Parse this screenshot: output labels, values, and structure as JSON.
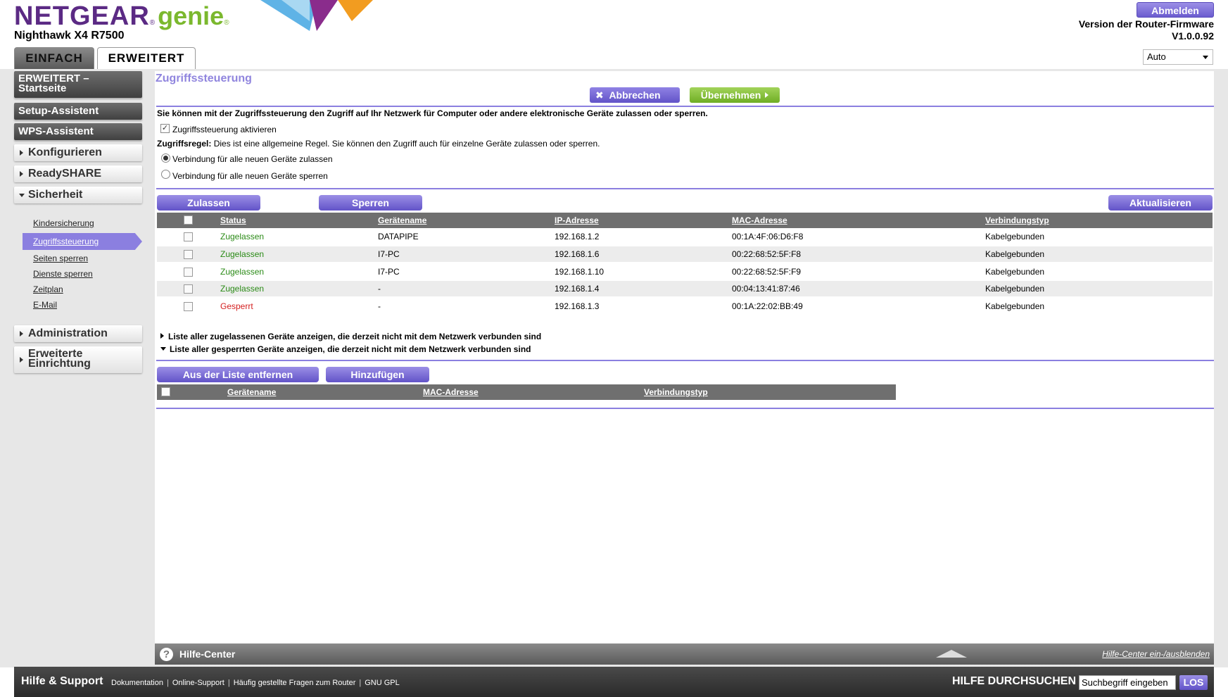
{
  "header": {
    "brand": "NETGEAR",
    "brand_reg": "®",
    "product": "genie",
    "product_reg": "®",
    "model": "Nighthawk X4 R7500",
    "logout_label": "Abmelden",
    "firmware_label": "Version der Router-Firmware",
    "firmware_version": "V1.0.0.92",
    "language_selected": "Auto",
    "tabs": [
      "EINFACH",
      "ERWEITERT"
    ]
  },
  "sidebar": {
    "dark_items": [
      "ERWEITERT –",
      "Startseite",
      "Setup-Assistent",
      "WPS-Assistent"
    ],
    "sections": [
      "Konfigurieren",
      "ReadySHARE",
      "Sicherheit",
      "Administration",
      "Erweiterte",
      "Einrichtung"
    ],
    "security_items": [
      "Kindersicherung",
      "Zugriffssteuerung",
      "Seiten sperren",
      "Dienste sperren",
      "Zeitplan",
      "E-Mail"
    ]
  },
  "content": {
    "title": "Zugriffssteuerung",
    "cancel_label": "Abbrechen",
    "apply_label": "Übernehmen",
    "intro": "Sie können mit der Zugriffssteuerung den Zugriff auf Ihr Netzwerk für Computer oder andere elektronische Geräte zulassen oder sperren.",
    "enable_label": "Zugriffssteuerung aktivieren",
    "rule_label": "Zugriffsregel:",
    "rule_text": "Dies ist eine allgemeine Regel. Sie können den Zugriff auch für einzelne Geräte zulassen oder sperren.",
    "radio_allow": "Verbindung für alle neuen Geräte zulassen",
    "radio_block": "Verbindung für alle neuen Geräte sperren",
    "btn_allow": "Zulassen",
    "btn_block": "Sperren",
    "btn_refresh": "Aktualisieren",
    "table_headers": [
      "Status",
      "Gerätename",
      "IP-Adresse",
      "MAC-Adresse",
      "Verbindungstyp"
    ],
    "rows": [
      {
        "status": "Zugelassen",
        "name": "DATAPIPE",
        "ip": "192.168.1.2",
        "mac": "00:1A:4F:06:D6:F8",
        "type": "Kabelgebunden"
      },
      {
        "status": "Zugelassen",
        "name": "I7-PC",
        "ip": "192.168.1.6",
        "mac": "00:22:68:52:5F:F8",
        "type": "Kabelgebunden"
      },
      {
        "status": "Zugelassen",
        "name": "I7-PC",
        "ip": "192.168.1.10",
        "mac": "00:22:68:52:5F:F9",
        "type": "Kabelgebunden"
      },
      {
        "status": "Zugelassen",
        "name": "-",
        "ip": "192.168.1.4",
        "mac": "00:04:13:41:87:46",
        "type": "Kabelgebunden"
      },
      {
        "status": "Gesperrt",
        "name": "-",
        "ip": "192.168.1.3",
        "mac": "00:1A:22:02:BB:49",
        "type": "Kabelgebunden"
      }
    ],
    "expander_allowed": "Liste aller zugelassenen Geräte anzeigen, die derzeit nicht mit dem Netzwerk verbunden sind",
    "expander_blocked": "Liste aller gesperrten Geräte anzeigen, die derzeit nicht mit dem Netzwerk verbunden sind",
    "btn_remove": "Aus der Liste entfernen",
    "btn_add": "Hinzufügen",
    "blocked_headers": [
      "Gerätename",
      "MAC-Adresse",
      "Verbindungstyp"
    ]
  },
  "help": {
    "icon": "?",
    "title": "Hilfe-Center",
    "toggle_link": "Hilfe-Center ein-/ausblenden"
  },
  "footer": {
    "title": "Hilfe & Support",
    "links": [
      "Dokumentation",
      "Online-Support",
      "Häufig gestellte Fragen zum Router",
      "GNU GPL"
    ],
    "search_label": "HILFE DURCHSUCHEN",
    "search_placeholder": "Suchbegriff eingeben",
    "search_button": "LOS"
  },
  "colors": {
    "accent_purple": "#8b7fe0",
    "apply_green": "#7bb82e",
    "status_allowed": "#2a8a16",
    "status_blocked": "#d42020"
  }
}
